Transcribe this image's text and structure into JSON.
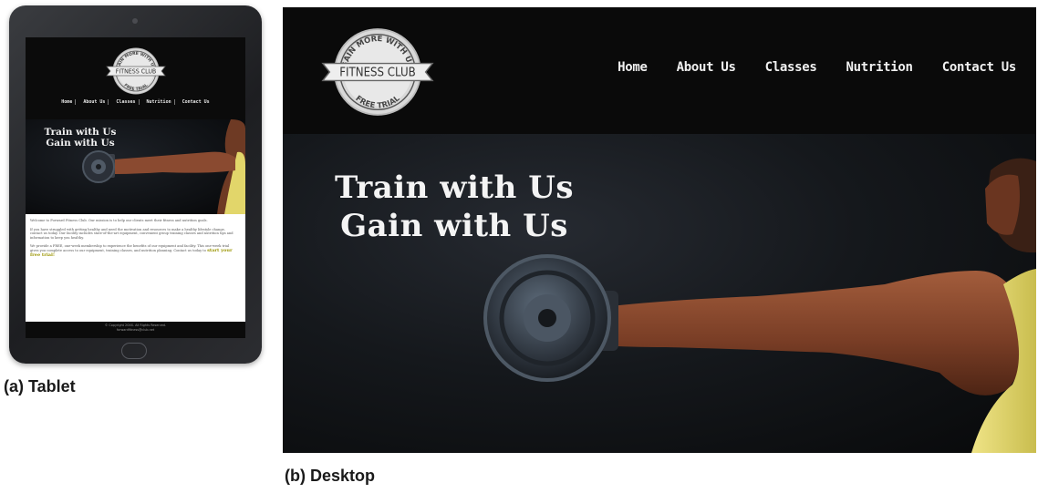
{
  "tablet": {
    "logo": {
      "top_text": "GAIN MORE WITH US",
      "main_text": "FITNESS CLUB",
      "bottom_text": "FREE TRIAL"
    },
    "nav": [
      "Home",
      "About Us",
      "Classes",
      "Nutrition",
      "Contact Us"
    ],
    "hero": {
      "line1": "Train with Us",
      "line2": "Gain with Us"
    },
    "content": {
      "p1": "Welcome to Forward Fitness Club. Our mission is to help our clients meet their fitness and nutrition goals.",
      "p2": "If you have struggled with getting healthy and need the motivation and resources to make a healthy lifestyle change, contact us today. Our facility includes state-of-the-art equipment, convenient group training classes and nutrition tips and information to keep you healthy.",
      "p3": "We provide a FREE, one-week membership to experience the benefits of our equipment and facility. This one-week trial gives you complete access to our equipment, training classes, and nutrition planning. Contact us today to",
      "cta": "start your free trial!"
    },
    "footer": {
      "copyright": "© Copyright 20XX. All Rights Reserved.",
      "email": "forwardfitness@club.net"
    }
  },
  "captions": {
    "tablet": "(a) Tablet",
    "desktop": "(b) Desktop"
  },
  "desktop": {
    "logo": {
      "top_text": "GAIN MORE WITH US",
      "main_text": "FITNESS CLUB",
      "bottom_text": "FREE TRIAL"
    },
    "nav": [
      "Home",
      "About Us",
      "Classes",
      "Nutrition",
      "Contact Us"
    ],
    "hero": {
      "line1": "Train with Us",
      "line2": "Gain with Us"
    }
  },
  "colors": {
    "header_bg": "#0a0a0a",
    "hero_text": "#f4f4f4",
    "cta_text": "#9a9400",
    "tank_top": "#e6db6a",
    "skin": "#8a4a30"
  }
}
